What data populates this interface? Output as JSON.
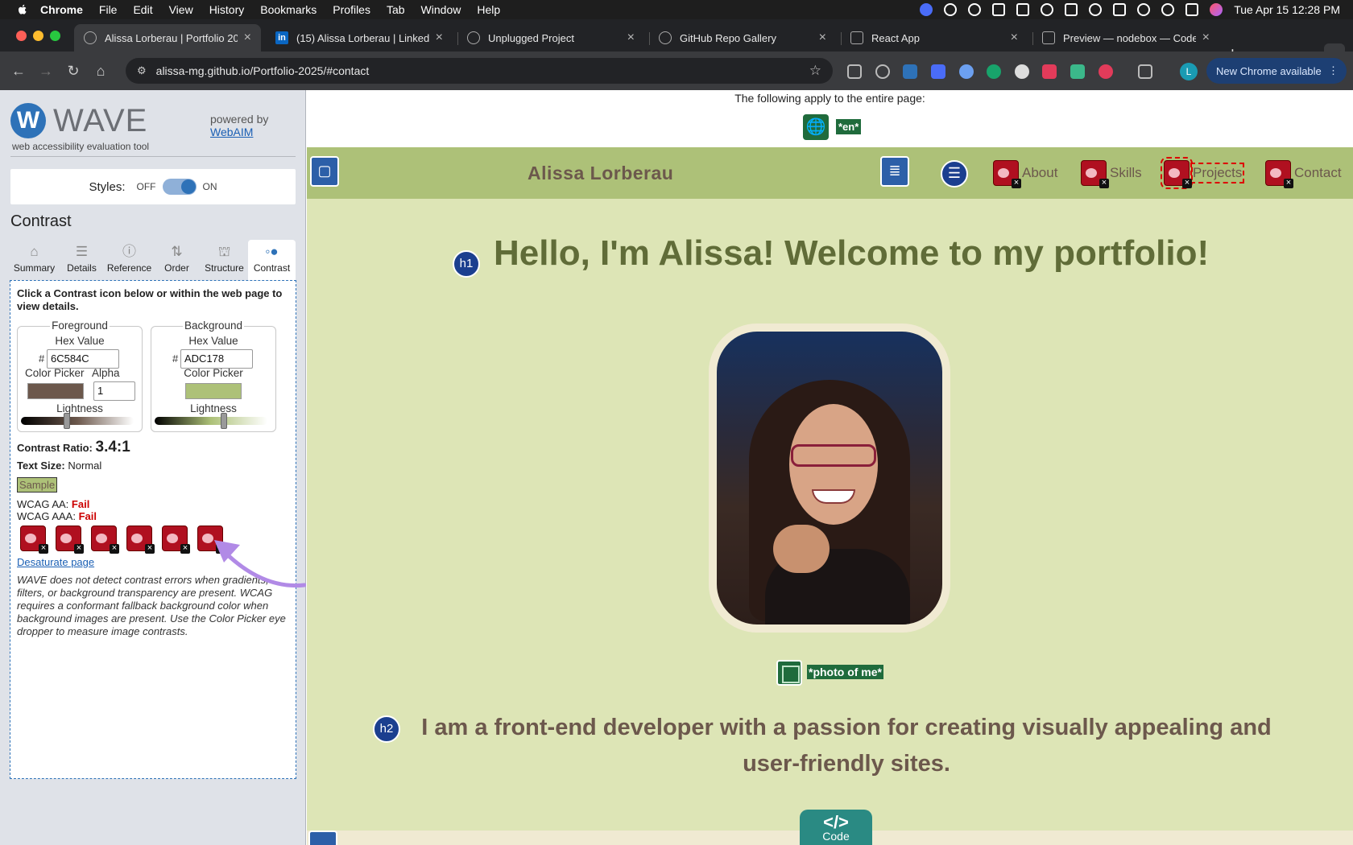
{
  "menubar": {
    "app": "Chrome",
    "items": [
      "File",
      "Edit",
      "View",
      "History",
      "Bookmarks",
      "Profiles",
      "Tab",
      "Window",
      "Help"
    ],
    "datetime": "Tue Apr 15  12:28 PM"
  },
  "tabs": [
    {
      "label": "Alissa Lorberau | Portfolio 2025",
      "active": true
    },
    {
      "label": "(15) Alissa Lorberau | LinkedIn",
      "active": false
    },
    {
      "label": "Unplugged Project",
      "active": false
    },
    {
      "label": "GitHub Repo Gallery",
      "active": false
    },
    {
      "label": "React App",
      "active": false
    },
    {
      "label": "Preview — nodebox — CodeSandbox",
      "active": false
    }
  ],
  "toolbar": {
    "url": "alissa-mg.github.io/Portfolio-2025/#contact",
    "profile_initial": "L",
    "update_label": "New Chrome available"
  },
  "wave": {
    "name": "WAVE",
    "subtitle": "web accessibility evaluation tool",
    "powered_by": "powered by",
    "webaim": "WebAIM",
    "styles_label": "Styles:",
    "styles_off": "OFF",
    "styles_on": "ON",
    "panel_title": "Contrast",
    "tabs": [
      "Summary",
      "Details",
      "Reference",
      "Order",
      "Structure",
      "Contrast"
    ],
    "intro": "Click a Contrast icon below or within the web page to view details.",
    "foreground": {
      "legend": "Foreground",
      "hex_label": "Hex Value",
      "hex": "6C584C",
      "picker_label": "Color Picker",
      "alpha_label": "Alpha",
      "alpha": "1",
      "lightness_label": "Lightness",
      "color": "#6C584C",
      "lightness": 0.4
    },
    "background": {
      "legend": "Background",
      "hex_label": "Hex Value",
      "hex": "ADC178",
      "picker_label": "Color Picker",
      "lightness_label": "Lightness",
      "color": "#ADC178",
      "lightness": 0.62
    },
    "hash": "#",
    "ratio_label": "Contrast Ratio:",
    "ratio": "3.4:1",
    "text_size_label": "Text Size:",
    "text_size": "Normal",
    "sample": "Sample",
    "aa_label": "WCAG AA:",
    "aa": "Fail",
    "aaa_label": "WCAG AAA:",
    "aaa": "Fail",
    "desaturate": "Desaturate page",
    "note": "WAVE does not detect contrast errors when gradients, filters, or background transparency are present. WCAG requires a conformant fallback background color when background images are present. Use the Color Picker eye dropper to measure image contrasts."
  },
  "page": {
    "info": "The following apply to the entire page:",
    "lang": "*en*",
    "brand": "Alissa Lorberau",
    "nav": [
      "About",
      "Skills",
      "Projects",
      "Contact"
    ],
    "h1_tag": "h1",
    "h1": "Hello, I'm Alissa! Welcome to my portfolio!",
    "alt": "*photo of me*",
    "h2_tag": "h2",
    "h2": "I am a front-end developer with a passion for creating visually appealing and user-friendly sites.",
    "code_glyph": "</>",
    "code_label": "Code",
    "colors": {
      "bg": "#dde5b6",
      "nav": "#adc178",
      "text": "#6c584c",
      "heading": "#606c38",
      "frame": "#f0ead2"
    }
  }
}
